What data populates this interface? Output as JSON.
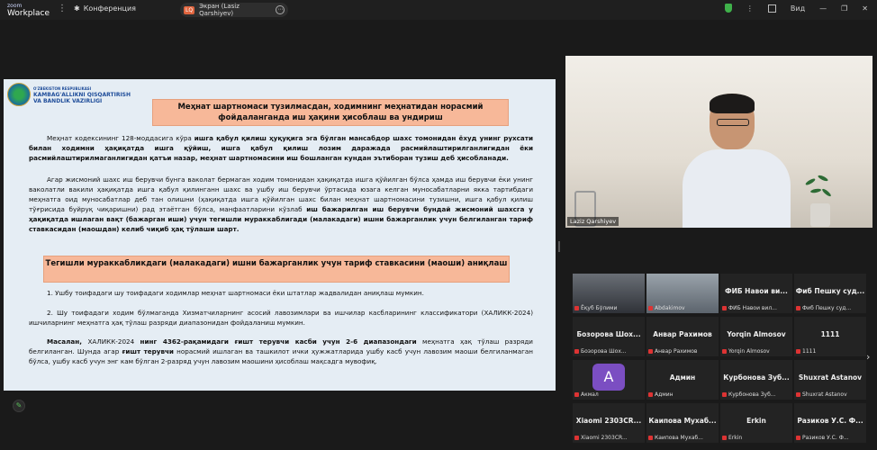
{
  "app": {
    "brand_line1": "zoom",
    "brand_line2": "Workplace"
  },
  "topbar": {
    "conference_label": "Конференция",
    "screen_share_label": "Экран (Lasiz Qarshiyev)",
    "share_badge": "LQ",
    "view_label": "Вид"
  },
  "slide": {
    "org_line1": "O'ZBEKISTON RESPUBLIKASI",
    "org_line2": "KAMBAG'ALLIKNI QISQARTIRISH",
    "org_line3": "VA BANDLIK VAZIRLIGI",
    "title": "Меҳнат шартномаси тузилмасдан, ходимнинг меҳнатидан норасмий фойдаланганда иш ҳақини ҳисоблаш ва ундириш",
    "para1_a": "Меҳнат кодексининг 128-моддасига кўра ",
    "para1_b": "ишга қабул қилиш ҳуқуқига эга бўлган мансабдор шахс томонидан ёхуд унинг рухсати билан ходимни ҳақиқатда ишга қўйиш, ишга қабул қилиш лозим даражада расмийлаштирилганлигидан ёки расмийлаштирилмаганлигидан қатъи назар, меҳнат шартномасини иш бошланган кундан эътиборан тузиш деб ҳисобланади.",
    "para2_a": "Агар жисмоний шахс иш берувчи бунга ваколат бермаган ходим томонидан ҳақиқатда ишга қўйилган бўлса ҳамда иш берувчи ёки унинг ваколатли вакили ҳақиқатда ишга қабул қилинганн шахс ва ушбу иш берувчи ўртасида юзага келган муносабатларни якка тартибдаги меҳнатга оид муносабатлар деб тан олишни (ҳақиқатда ишга қўйилган шахс билан меҳнат шартномасини тузишни, ишга қабул қилиш тўғрисида буйруқ чиқаришни) рад этаётган бўлса, манфаатларини кўзлаб ",
    "para2_b": "иш бажарилган иш берувчи бундай жисмоний шахсга у ҳақиқатда ишлаган вақт (бажарган иши) учун тегишли мураккаблигади (малакадаги) ишни бажарганлик учун белгиланган тариф ставкасидан (маошдан) келиб чиқиб ҳақ тўлаши шарт.",
    "subtitle": "Тегишли мураккабликдаги (малакадаги) ишни бажарганлик учун тариф ставкасини (маоши) аниқлаш",
    "item1": "1. Ушбу тоифадаги шу тоифадаги ходимлар меҳнат шартномаси ёки штатлар жадвалидан аниқлаш мумкин.",
    "item2": "2. Шу тоифадаги ходим бўлмаганда Хизматчиларнинг асосий лавозимлари ва ишчилар касбларининг классификатори (ХАЛИКК-2024) ишчиларнинг меҳнатга ҳақ тўлаш разряди диапазонидан фойдаланиш мумкин.",
    "example_a": "Масалан, ",
    "example_b": "ХАЛИКК-2024 ",
    "example_c": "нинг 4362-рақамидаги ғишт терувчи касби учун 2-6 диапазондаги",
    "example_d": " меҳнатга ҳақ тўлаш разряди белгиланган. Шунда агар ",
    "example_e": "ғишт терувчи",
    "example_f": " норасмий ишлаган ва ташкилот ички ҳужжатларида ушбу касб учун лавозим маоши белгиланмаган бўлса, ушбу касб учун энг кам бўлган 2-разряд учун лавозим маошини ҳисоблаш мақсадга мувофиқ."
  },
  "speaker": {
    "name": "Laziz Qarshiyev"
  },
  "participants": [
    {
      "name": "",
      "label": "Ёқуб Бўлими",
      "video": "video1"
    },
    {
      "name": "",
      "label": "Abdakimov",
      "video": "video2"
    },
    {
      "name": "ФИБ Навои ви...",
      "label": "ФИБ Навои вил..."
    },
    {
      "name": "Фиб Пешку суд...",
      "label": "Фиб Пешку суд..."
    },
    {
      "name": "Бозорова Шох...",
      "label": "Бозорова Шох..."
    },
    {
      "name": "Анвар Рахимов",
      "label": "Анвар Рахимов"
    },
    {
      "name": "Yorqin Almosov",
      "label": "Yorqin Almosov"
    },
    {
      "name": "1111",
      "label": "1111"
    },
    {
      "name": "",
      "label": "Акмал",
      "avatar": "A"
    },
    {
      "name": "Админ",
      "label": "Админ"
    },
    {
      "name": "Курбонова Зуб...",
      "label": "Курбонова Зуб..."
    },
    {
      "name": "Shuxrat Astanov",
      "label": "Shuxrat Astanov"
    },
    {
      "name": "Xiaomi 2303CR...",
      "label": "Xiaomi 2303CR..."
    },
    {
      "name": "Каипова Мухаб...",
      "label": "Каипова Мухаб..."
    },
    {
      "name": "Erkin",
      "label": "Erkin"
    },
    {
      "name": "Разиков У.С. Ф...",
      "label": "Разиков У.С. Ф..."
    }
  ]
}
